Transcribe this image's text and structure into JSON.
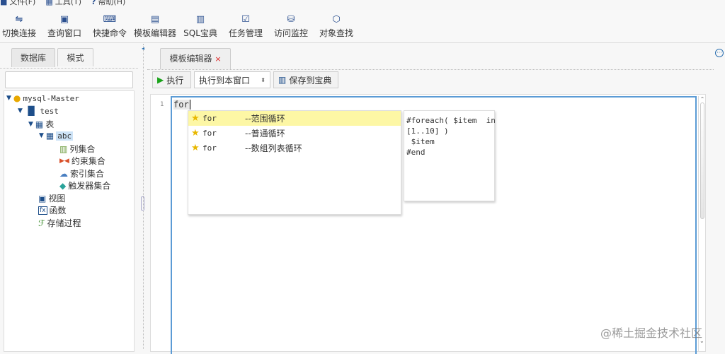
{
  "menu": [
    "文件(F)",
    "工具(T)",
    "帮助(H)"
  ],
  "toolbar": [
    {
      "label": "切换连接",
      "icon": "switch-icon"
    },
    {
      "label": "查询窗口",
      "icon": "query-window-icon"
    },
    {
      "label": "快捷命令",
      "icon": "terminal-icon"
    },
    {
      "label": "模板编辑器",
      "icon": "template-editor-icon"
    },
    {
      "label": "SQL宝典",
      "icon": "book-icon"
    },
    {
      "label": "任务管理",
      "icon": "clipboard-icon"
    },
    {
      "label": "访问监控",
      "icon": "database-monitor-icon"
    },
    {
      "label": "对象查找",
      "icon": "object-search-icon"
    }
  ],
  "left": {
    "tabs": [
      "数据库",
      "模式"
    ],
    "search_value": ""
  },
  "tree": [
    {
      "label": "mysql-Master"
    },
    {
      "label": "test"
    },
    {
      "label": "表"
    },
    {
      "label": "abc"
    },
    {
      "label": "列集合"
    },
    {
      "label": "约束集合"
    },
    {
      "label": "索引集合"
    },
    {
      "label": "触发器集合"
    },
    {
      "label": "视图"
    },
    {
      "label": "函数"
    },
    {
      "label": "存储过程"
    }
  ],
  "editor_tab": {
    "label": "模板编辑器",
    "close": "×"
  },
  "actions": {
    "run": "执行",
    "target": "执行到本窗口",
    "save": "保存到宝典"
  },
  "editor": {
    "line": "1",
    "text": "for"
  },
  "completions": [
    {
      "keyword": "for",
      "desc": "--范围循环"
    },
    {
      "keyword": "for",
      "desc": "--普通循环"
    },
    {
      "keyword": "for",
      "desc": "--数组列表循环"
    }
  ],
  "doc": "#foreach( $item  in\n[1..10] )\n $item\n#end",
  "watermark": "@稀土掘金技术社区",
  "colors": {
    "accent": "#5b9bd5",
    "highlight": "#fdf7a5",
    "run": "#1aa31a"
  }
}
